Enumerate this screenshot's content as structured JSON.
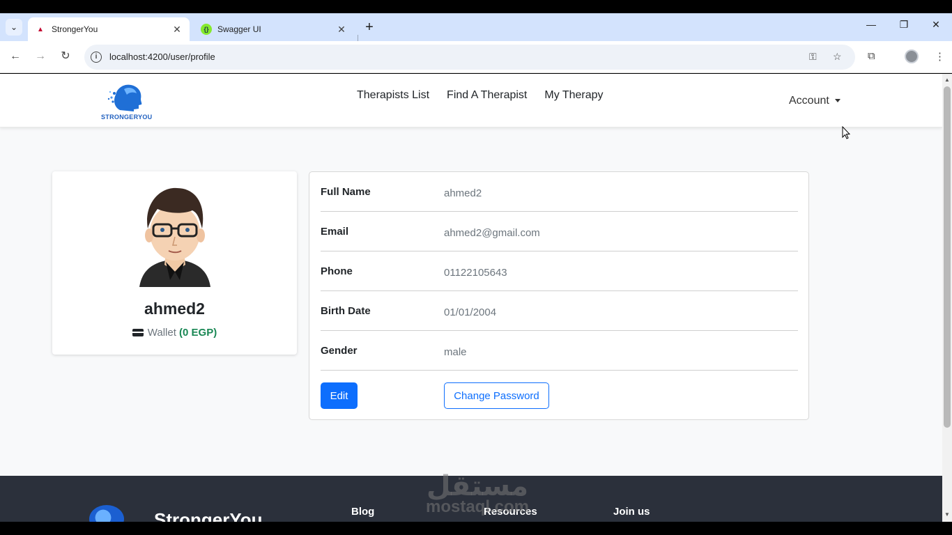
{
  "browser": {
    "tabs": [
      {
        "title": "StrongerYou",
        "active": true
      },
      {
        "title": "Swagger UI",
        "active": false
      }
    ],
    "url": "localhost:4200/user/profile"
  },
  "navbar": {
    "logo_text": "STRONGERYOU",
    "links": [
      "Therapists List",
      "Find A Therapist",
      "My Therapy"
    ],
    "account_label": "Account"
  },
  "profile": {
    "username": "ahmed2",
    "wallet_label": "Wallet",
    "wallet_amount": "(0 EGP)"
  },
  "details": [
    {
      "label": "Full Name",
      "value": "ahmed2"
    },
    {
      "label": "Email",
      "value": "ahmed2@gmail.com"
    },
    {
      "label": "Phone",
      "value": "01122105643"
    },
    {
      "label": "Birth Date",
      "value": "01/01/2004"
    },
    {
      "label": "Gender",
      "value": "male"
    }
  ],
  "actions": {
    "edit_label": "Edit",
    "change_password_label": "Change Password"
  },
  "footer": {
    "brand": "StrongerYou",
    "columns": [
      "Blog",
      "Resources",
      "Join us"
    ]
  },
  "watermark": {
    "arabic": "مستقل",
    "latin": "mostaql.com"
  },
  "colors": {
    "primary": "#0d6efd",
    "wallet_amount": "#198754",
    "footer_bg": "#2b303b"
  }
}
